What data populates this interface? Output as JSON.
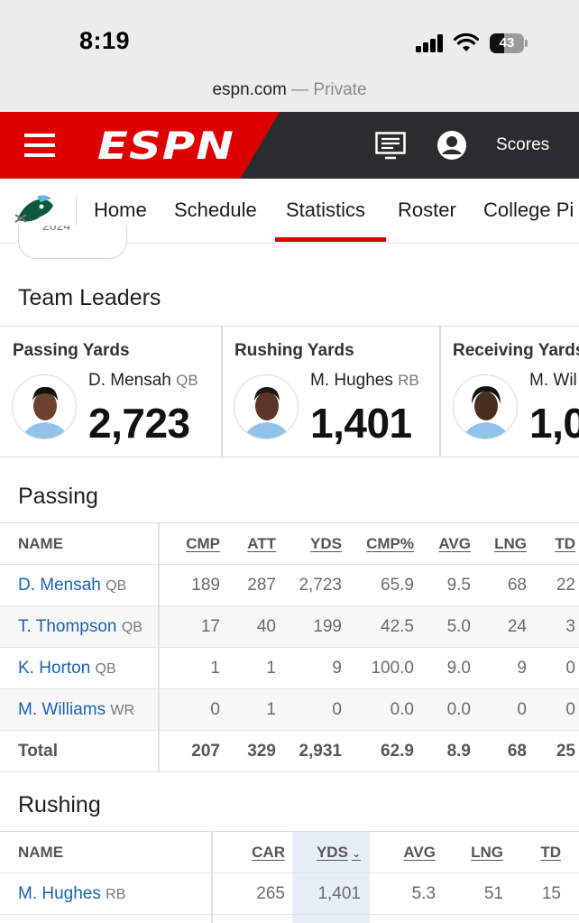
{
  "status_bar": {
    "time": "8:19",
    "battery": "43",
    "battery_level": 0.43
  },
  "browser": {
    "domain": "espn.com",
    "private_label": "— Private"
  },
  "header": {
    "logo": "ESPN",
    "scores_label": "Scores",
    "menu_icon": "hamburger-menu-icon",
    "watch_icon": "tv-icon",
    "profile_icon": "profile-icon"
  },
  "subnav": {
    "tabs": [
      "Home",
      "Schedule",
      "Statistics",
      "Roster",
      "College Pi"
    ],
    "active_tab": "Statistics"
  },
  "season_pill": "2024",
  "team_leaders": {
    "title": "Team Leaders",
    "cards": [
      {
        "category": "Passing Yards",
        "name": "D. Mensah",
        "pos": "QB",
        "value": "2,723"
      },
      {
        "category": "Rushing Yards",
        "name": "M. Hughes",
        "pos": "RB",
        "value": "1,401"
      },
      {
        "category": "Receiving Yards",
        "name": "M. Wil",
        "pos": "",
        "value": "1,0"
      }
    ]
  },
  "passing": {
    "title": "Passing",
    "columns": [
      "NAME",
      "CMP",
      "ATT",
      "YDS",
      "CMP%",
      "AVG",
      "LNG",
      "TD"
    ],
    "rows": [
      {
        "name": "D. Mensah",
        "pos": "QB",
        "cmp": "189",
        "att": "287",
        "yds": "2,723",
        "cmp_pct": "65.9",
        "avg": "9.5",
        "lng": "68",
        "td": "22"
      },
      {
        "name": "T. Thompson",
        "pos": "QB",
        "cmp": "17",
        "att": "40",
        "yds": "199",
        "cmp_pct": "42.5",
        "avg": "5.0",
        "lng": "24",
        "td": "3"
      },
      {
        "name": "K. Horton",
        "pos": "QB",
        "cmp": "1",
        "att": "1",
        "yds": "9",
        "cmp_pct": "100.0",
        "avg": "9.0",
        "lng": "9",
        "td": "0"
      },
      {
        "name": "M. Williams",
        "pos": "WR",
        "cmp": "0",
        "att": "1",
        "yds": "0",
        "cmp_pct": "0.0",
        "avg": "0.0",
        "lng": "0",
        "td": "0"
      }
    ],
    "total": {
      "label": "Total",
      "cmp": "207",
      "att": "329",
      "yds": "2,931",
      "cmp_pct": "62.9",
      "avg": "8.9",
      "lng": "68",
      "td": "25"
    }
  },
  "rushing": {
    "title": "Rushing",
    "columns": [
      "NAME",
      "CAR",
      "YDS",
      "AVG",
      "LNG",
      "TD"
    ],
    "sorted_column": "YDS",
    "rows": [
      {
        "name": "M. Hughes",
        "pos": "RB",
        "car": "265",
        "yds": "1,401",
        "avg": "5.3",
        "lng": "51",
        "td": "15"
      }
    ]
  },
  "colors": {
    "espn_red": "#dd0000",
    "header_dark": "#2b2c2d",
    "link_blue": "#1a63b0",
    "team_green": "#0b5a3c"
  }
}
